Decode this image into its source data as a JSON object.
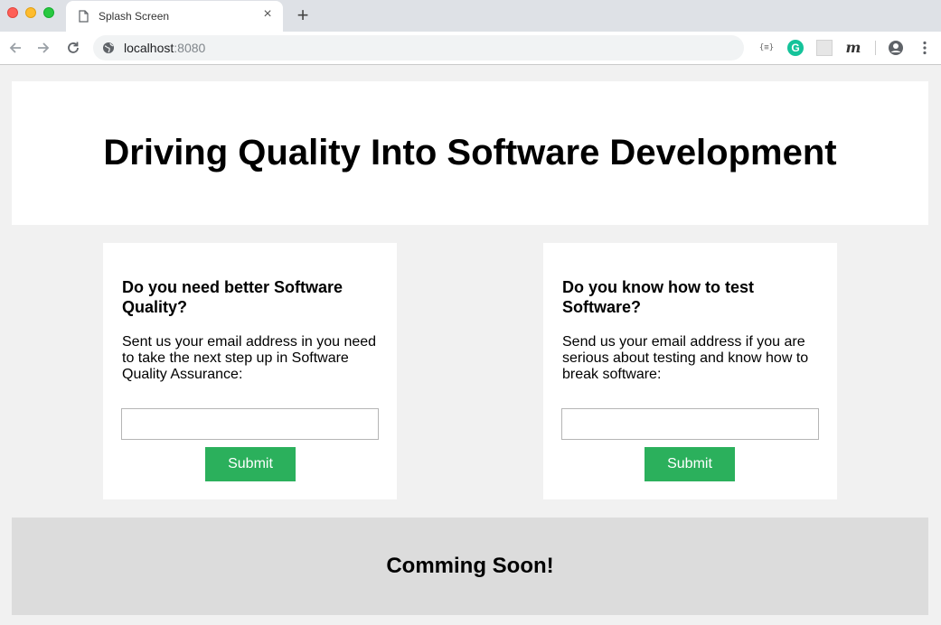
{
  "browser": {
    "tab_title": "Splash Screen",
    "new_tab_icon": "plus-icon",
    "url_host": "localhost",
    "url_port": ":8080",
    "extensions": [
      "json-viewer-icon",
      "grammarly-icon",
      "extension-icon",
      "m-extension-icon"
    ],
    "json_ext_label": "{≡}",
    "grammarly_letter": "G",
    "m_ext_letter": "m"
  },
  "hero": {
    "title": "Driving Quality Into Software Development"
  },
  "cards": [
    {
      "heading": "Do you need better Software Quality?",
      "description": "Sent us your email address in you need to take the next step up in Software Quality Assurance:",
      "input_value": "",
      "submit_label": "Submit"
    },
    {
      "heading": "Do you know how to test Software?",
      "description": "Send us your email address if you are serious about testing and know how to break software:",
      "input_value": "",
      "submit_label": "Submit"
    }
  ],
  "footer": {
    "text": "Comming Soon!"
  },
  "colors": {
    "submit_button": "#2bb05c",
    "page_background": "#f1f1f1",
    "footer_background": "#dcdcdc"
  }
}
